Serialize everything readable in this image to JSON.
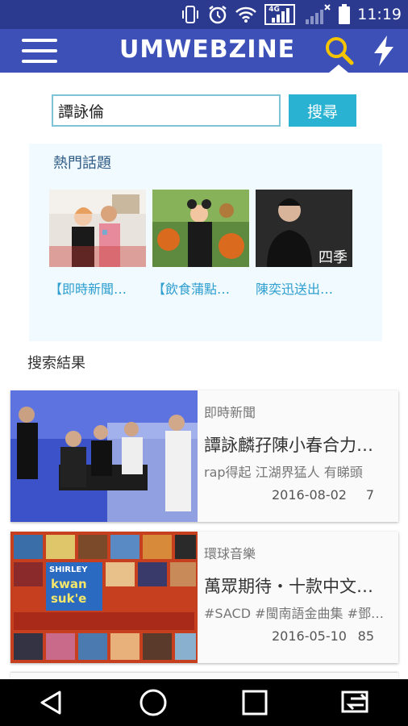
{
  "status_bar": {
    "time": "11:19",
    "network_label": "4G"
  },
  "app_bar": {
    "logo_text": "UMWEBZINE"
  },
  "search": {
    "value": "譚詠倫",
    "button_label": "搜尋"
  },
  "hot_topics": {
    "title": "熱門話題",
    "items": [
      {
        "caption": "【即時新聞…"
      },
      {
        "caption": "【飲食蒲點…"
      },
      {
        "caption": "陳奕迅送出…",
        "image_text": "四季"
      }
    ]
  },
  "results": {
    "title": "搜索結果",
    "cards": [
      {
        "category": "即時新聞",
        "title": "譚詠麟孖陳小春合力…",
        "subtitle": "rap得起 江湖界猛人 有睇頭",
        "date": "2016-08-02",
        "count": "7"
      },
      {
        "category": "環球音樂",
        "title": "萬眾期待・十款中文…",
        "subtitle": "#SACD #閩南語金曲集 #鄧…",
        "date": "2016-05-10",
        "count": "85",
        "image_texts": [
          "SHIRLEY",
          "kwan",
          "suk'e"
        ]
      }
    ]
  },
  "colors": {
    "status_bar": "#2b3a8f",
    "app_bar": "#3c50b8",
    "accent": "#29b2d1",
    "search_icon": "#f5c400"
  },
  "icons": [
    "menu-icon",
    "search-icon",
    "flash-icon",
    "back-icon",
    "home-icon",
    "recents-icon",
    "switch-app-icon"
  ]
}
